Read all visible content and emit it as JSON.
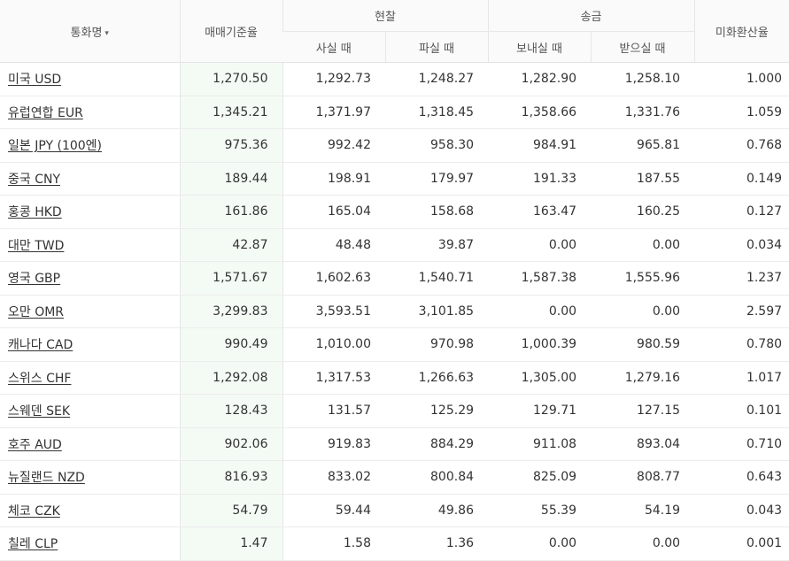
{
  "header": {
    "currency": "통화명",
    "sort_arrow": "▾",
    "base_rate": "매매기준율",
    "cash": "현찰",
    "cash_buy": "사실 때",
    "cash_sell": "파실 때",
    "transfer": "송금",
    "transfer_send": "보내실 때",
    "transfer_receive": "받으실 때",
    "usd_rate": "미화환산율"
  },
  "rows": [
    {
      "name": "미국 USD",
      "base": "1,270.50",
      "cash_buy": "1,292.73",
      "cash_sell": "1,248.27",
      "send": "1,282.90",
      "receive": "1,258.10",
      "usd": "1.000"
    },
    {
      "name": "유럽연합 EUR",
      "base": "1,345.21",
      "cash_buy": "1,371.97",
      "cash_sell": "1,318.45",
      "send": "1,358.66",
      "receive": "1,331.76",
      "usd": "1.059"
    },
    {
      "name": "일본 JPY (100엔)",
      "base": "975.36",
      "cash_buy": "992.42",
      "cash_sell": "958.30",
      "send": "984.91",
      "receive": "965.81",
      "usd": "0.768"
    },
    {
      "name": "중국 CNY",
      "base": "189.44",
      "cash_buy": "198.91",
      "cash_sell": "179.97",
      "send": "191.33",
      "receive": "187.55",
      "usd": "0.149"
    },
    {
      "name": "홍콩 HKD",
      "base": "161.86",
      "cash_buy": "165.04",
      "cash_sell": "158.68",
      "send": "163.47",
      "receive": "160.25",
      "usd": "0.127"
    },
    {
      "name": "대만 TWD",
      "base": "42.87",
      "cash_buy": "48.48",
      "cash_sell": "39.87",
      "send": "0.00",
      "receive": "0.00",
      "usd": "0.034"
    },
    {
      "name": "영국 GBP",
      "base": "1,571.67",
      "cash_buy": "1,602.63",
      "cash_sell": "1,540.71",
      "send": "1,587.38",
      "receive": "1,555.96",
      "usd": "1.237"
    },
    {
      "name": "오만 OMR",
      "base": "3,299.83",
      "cash_buy": "3,593.51",
      "cash_sell": "3,101.85",
      "send": "0.00",
      "receive": "0.00",
      "usd": "2.597"
    },
    {
      "name": "캐나다 CAD",
      "base": "990.49",
      "cash_buy": "1,010.00",
      "cash_sell": "970.98",
      "send": "1,000.39",
      "receive": "980.59",
      "usd": "0.780"
    },
    {
      "name": "스위스 CHF",
      "base": "1,292.08",
      "cash_buy": "1,317.53",
      "cash_sell": "1,266.63",
      "send": "1,305.00",
      "receive": "1,279.16",
      "usd": "1.017"
    },
    {
      "name": "스웨덴 SEK",
      "base": "128.43",
      "cash_buy": "131.57",
      "cash_sell": "125.29",
      "send": "129.71",
      "receive": "127.15",
      "usd": "0.101"
    },
    {
      "name": "호주 AUD",
      "base": "902.06",
      "cash_buy": "919.83",
      "cash_sell": "884.29",
      "send": "911.08",
      "receive": "893.04",
      "usd": "0.710"
    },
    {
      "name": "뉴질랜드 NZD",
      "base": "816.93",
      "cash_buy": "833.02",
      "cash_sell": "800.84",
      "send": "825.09",
      "receive": "808.77",
      "usd": "0.643"
    },
    {
      "name": "체코 CZK",
      "base": "54.79",
      "cash_buy": "59.44",
      "cash_sell": "49.86",
      "send": "55.39",
      "receive": "54.19",
      "usd": "0.043"
    },
    {
      "name": "칠레 CLP",
      "base": "1.47",
      "cash_buy": "1.58",
      "cash_sell": "1.36",
      "send": "0.00",
      "receive": "0.00",
      "usd": "0.001"
    }
  ]
}
